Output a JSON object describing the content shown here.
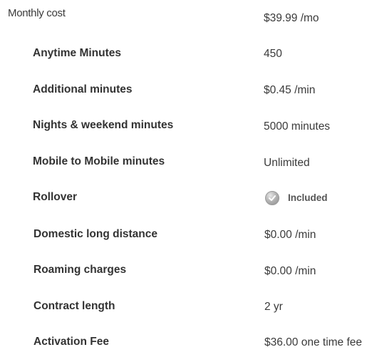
{
  "plan": {
    "rows": [
      {
        "label": "Monthly cost",
        "value": "$39.99 /mo"
      },
      {
        "label": "Anytime Minutes",
        "value": "450"
      },
      {
        "label": "Additional minutes",
        "value": "$0.45 /min"
      },
      {
        "label": "Nights & weekend minutes",
        "value": "5000 minutes"
      },
      {
        "label": "Mobile to Mobile minutes",
        "value": "Unlimited"
      },
      {
        "label": "Rollover",
        "value": "Included",
        "icon": "check-circle-icon"
      },
      {
        "label": "Domestic long distance",
        "value": "$0.00 /min"
      },
      {
        "label": "Roaming charges",
        "value": "$0.00 /min"
      },
      {
        "label": "Contract length",
        "value": "2 yr"
      },
      {
        "label": "Activation Fee",
        "value": "$36.00 one time fee"
      }
    ]
  },
  "colors": {
    "label_text": "#333333",
    "value_text": "#3a3a3a",
    "icon_gray": "#9a9a9a"
  }
}
